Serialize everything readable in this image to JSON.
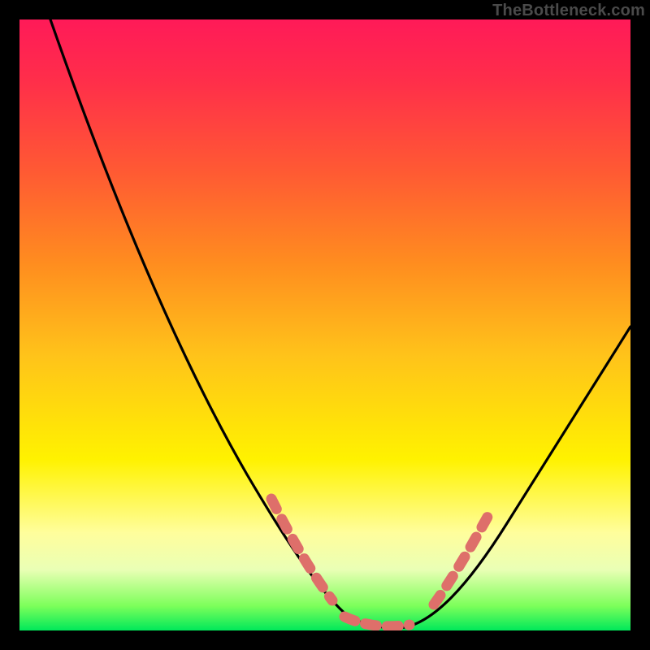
{
  "watermark": "TheBottleneck.com",
  "chart_data": {
    "type": "line",
    "title": "",
    "xlabel": "",
    "ylabel": "",
    "xlim": [
      0,
      100
    ],
    "ylim": [
      0,
      100
    ],
    "grid": false,
    "legend": false,
    "series": [
      {
        "name": "bottleneck-curve",
        "color": "#000000",
        "x": [
          5,
          10,
          15,
          20,
          25,
          30,
          35,
          40,
          45,
          47,
          50,
          53,
          55,
          58,
          60,
          63,
          68,
          75,
          82,
          90,
          100
        ],
        "y": [
          100,
          88,
          77,
          66,
          55,
          44,
          33,
          24,
          14,
          11,
          6,
          3,
          1.5,
          1,
          1,
          1.5,
          4,
          12,
          22,
          34,
          50
        ]
      },
      {
        "name": "dotted-left-segment",
        "color": "#e16464",
        "style": "dotted",
        "x": [
          40,
          42,
          44,
          46,
          48,
          50,
          52,
          54
        ],
        "y": [
          22,
          18,
          14,
          11,
          8,
          5,
          3,
          2
        ]
      },
      {
        "name": "dotted-bottom-segment",
        "color": "#e16464",
        "style": "dotted",
        "x": [
          55,
          57,
          59,
          61,
          63
        ],
        "y": [
          1.2,
          1,
          1,
          1.2,
          1.6
        ]
      },
      {
        "name": "dotted-right-segment",
        "color": "#e16464",
        "style": "dotted",
        "x": [
          67,
          69,
          71,
          73,
          75
        ],
        "y": [
          5,
          8,
          11,
          14,
          18
        ]
      }
    ]
  }
}
